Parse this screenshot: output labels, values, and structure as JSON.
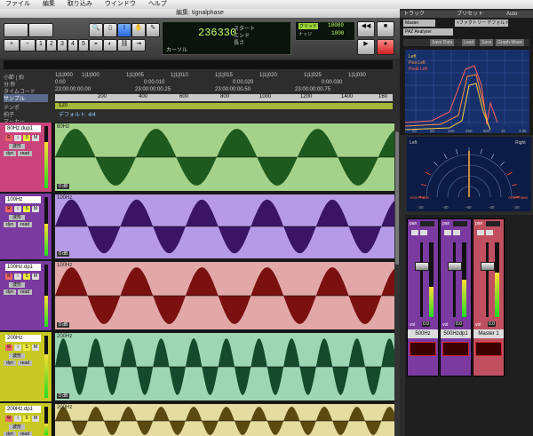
{
  "menubar": [
    "ファイル",
    "編集",
    "取り込み",
    "ウインドウ",
    "ヘルプ"
  ],
  "window_title": "編集: tignalphase",
  "transport": {
    "counter_main": "236330",
    "start_label": "スタート",
    "end_label": "エンド",
    "length_label": "長さ",
    "cursor_label": "カーソル",
    "grid_value": "10000",
    "nudge_value": "1000",
    "grid_label": "グリッド",
    "nudge_label": "ナッジ",
    "num_buttons": [
      "1",
      "2",
      "3",
      "4",
      "5"
    ]
  },
  "ruler": {
    "rows": [
      "小節 | 拍",
      "分:秒",
      "タイムコード",
      "サンプル",
      "テンポ",
      "拍子",
      "マーカー"
    ],
    "bars": [
      "1|1|000",
      "1|1|000",
      "1|1|005",
      "1|1|010",
      "1|1|015",
      "1|1|020",
      "1|1|025",
      "1|1|030",
      "1|1|035"
    ],
    "minsec": [
      "0:00",
      "0:00.010",
      "0:00.020",
      "0:00.030"
    ],
    "timecode": [
      "23:00:00:00.00",
      "23:00:00:00.25",
      "23:00:00:00.50",
      "23:00:00:00.75"
    ],
    "samples": [
      "200",
      "400",
      "600",
      "800",
      "1000",
      "1200",
      "1400",
      "160"
    ],
    "tempo": "120",
    "meter": "デフォルト: 4/4"
  },
  "tracks": [
    {
      "name": "80Hz.dup1",
      "clip": "80Hz",
      "db": "0 dB",
      "color": "#c8447a",
      "clipcolor": "#a4d28a",
      "wave": "#1e5a1e",
      "cycles": 4.2,
      "meter": 0.75
    },
    {
      "name": "100Hz",
      "clip": "100Hz",
      "db": "0 dB",
      "color": "#7a3aa0",
      "clipcolor": "#b79ae6",
      "wave": "#3a1565",
      "cycles": 5.2,
      "meter": 0.55
    },
    {
      "name": "100Hz.dp1",
      "clip": "100Hz",
      "db": "0 dB",
      "color": "#7a3aa0",
      "clipcolor": "#e2a8a8",
      "wave": "#7a1010",
      "cycles": 5.2,
      "meter": 0.5
    },
    {
      "name": "200Hz",
      "clip": "200Hz",
      "db": "0 dB",
      "color": "#c8c822",
      "clipcolor": "#9ed6b4",
      "wave": "#164a2c",
      "cycles": 10.4,
      "meter": 0.7
    },
    {
      "name": "200Hz.dp1",
      "clip": "200Hz",
      "db": "",
      "color": "#c8c822",
      "clipcolor": "#e4dca0",
      "wave": "#5a4a10",
      "cycles": 10.4,
      "meter": 0.4
    }
  ],
  "track_controls": {
    "s": "S",
    "m": "M",
    "rec": "R",
    "wave_label": "波形",
    "dyn": "dyn",
    "read": "read"
  },
  "plugin": {
    "track_label": "トラック",
    "preset_label": "プリセット",
    "auto_label": "Auto",
    "track_value": "Master",
    "preset_value": "<ファクトリー デフォルト>",
    "plugin_name": "PAZ Analyzer",
    "buttons": [
      "Save Data",
      "Load",
      "Save",
      "Graph-Wave"
    ],
    "legend": [
      "Left",
      "Pea Left",
      "Peak Left"
    ],
    "freq_ticks": [
      "20",
      "50",
      "100",
      "250",
      "500",
      "1k",
      "2.5k"
    ],
    "db_ticks": [
      "0",
      "-5",
      "-10",
      "-15",
      "-20",
      "-25"
    ]
  },
  "phase": {
    "left": "Left",
    "right": "Right",
    "anti_left": "Anti-Phase",
    "anti_right": "Anti-Phase",
    "ticks": [
      "-20",
      "-40",
      "-60",
      "-40",
      "-20"
    ]
  },
  "mixer": {
    "strips": [
      {
        "name": "500Hz",
        "color": "#7a3aa0",
        "vol": "0.0",
        "meter": 0.4
      },
      {
        "name": "500Hzdp1",
        "color": "#7a3aa0",
        "vol": "0.0",
        "meter": 0.5
      },
      {
        "name": "Master 1",
        "color": "#c05060",
        "vol": "0.0",
        "meter": 0.6
      }
    ],
    "pan_label": "pan",
    "vol_label": "vol"
  }
}
